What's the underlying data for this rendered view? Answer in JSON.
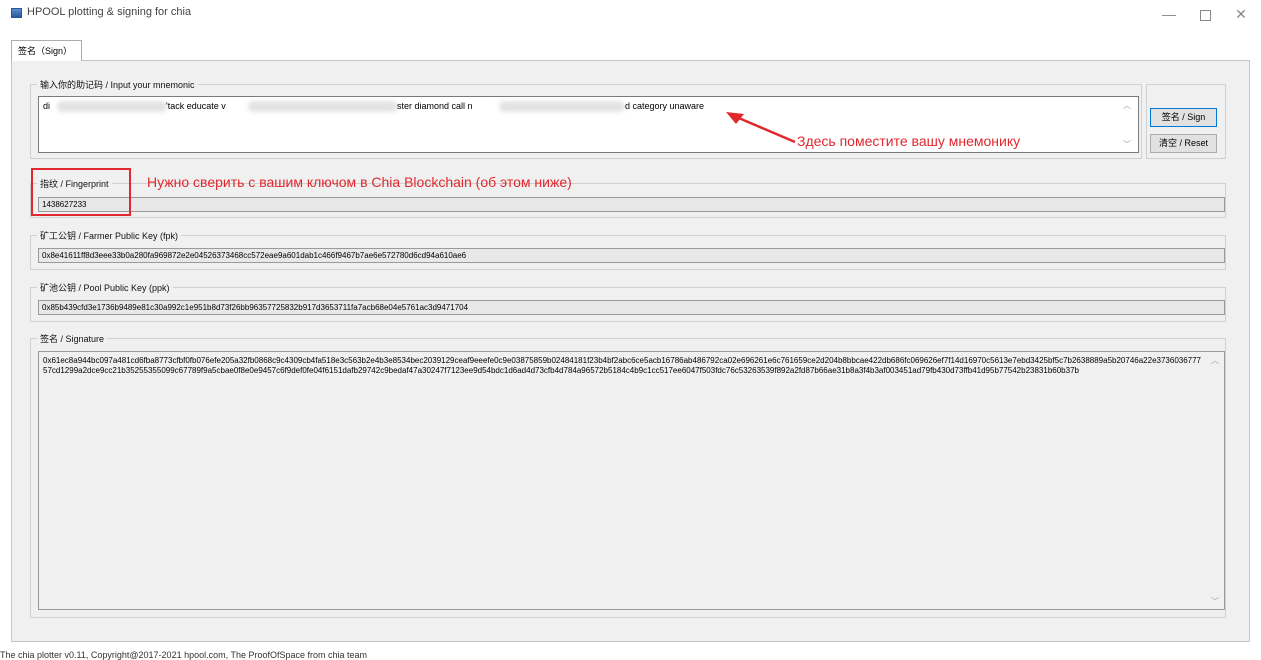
{
  "window": {
    "title": "HPOOL plotting & signing for chia",
    "minimize_glyph": "—",
    "close_glyph": "✕"
  },
  "tabs": [
    {
      "label": "签名（Sign）",
      "active": true
    }
  ],
  "mnemonic": {
    "group_title": "输入你的助记码 / Input your mnemonic",
    "visible_fragments": [
      "di",
      "'tack educate v",
      "ster diamond call n",
      "d category unaware"
    ]
  },
  "buttons": {
    "sign_label": "签名 / Sign",
    "reset_label": "清空 / Reset"
  },
  "fingerprint": {
    "group_title": "指纹 / Fingerprint",
    "value": "1438627233"
  },
  "farmer_key": {
    "group_title": "矿工公钥 / Farmer Public Key (fpk)",
    "value": "0x8e41611ff8d3eee33b0a280fa969872e2e04526373468cc572eae9a601dab1c466f9467b7ae6e572780d6cd94a610ae6"
  },
  "pool_key": {
    "group_title": "矿池公钥 / Pool Public Key (ppk)",
    "value": "0x85b439cfd3e1736b9489e81c30a992c1e951b8d73f26bb96357725832b917d3653711fa7acb68e04e5761ac3d9471704"
  },
  "signature": {
    "group_title": "签名 / Signature",
    "value": "0x61ec8a944bc097a481cd6fba8773cfbf0fb076efe205a32fb0868c9c4309cb4fa518e3c563b2e4b3e8534bec2039129ceaf9eeefe0c9e03875859b02484181f23b4bf2abc6ce5acb16786ab486792ca02e696261e6c761659ce2d204b8bbcae422db686fc069626ef7f14d16970c5613e7ebd3425bf5c7b2638889a5b20746a22e373603677757cd1299a2dce9cc21b35255355099c67789f9a5cbae0f8e0e9457c6f9def0fe04f6151dafb29742c9bedaf47a30247f7123ee9d54bdc1d6ad4d73cfb4d784a96572b5184c4b9c1cc517ee6047f503fdc76c53263539f892a2fd87b66ae31b8a3f4b3af003451ad79fb430d73ffb41d95b77542b23831b60b37b"
  },
  "annotations": {
    "mnemonic_hint": "Здесь поместите вашу мнемонику",
    "fingerprint_hint": "Нужно сверить с вашим ключом в Chia Blockchain (об этом ниже)",
    "color": "#e0282e"
  },
  "footer": {
    "text": "The chia plotter v0.11, Copyright@2017-2021 hpool.com, The ProofOfSpace from chia team"
  }
}
